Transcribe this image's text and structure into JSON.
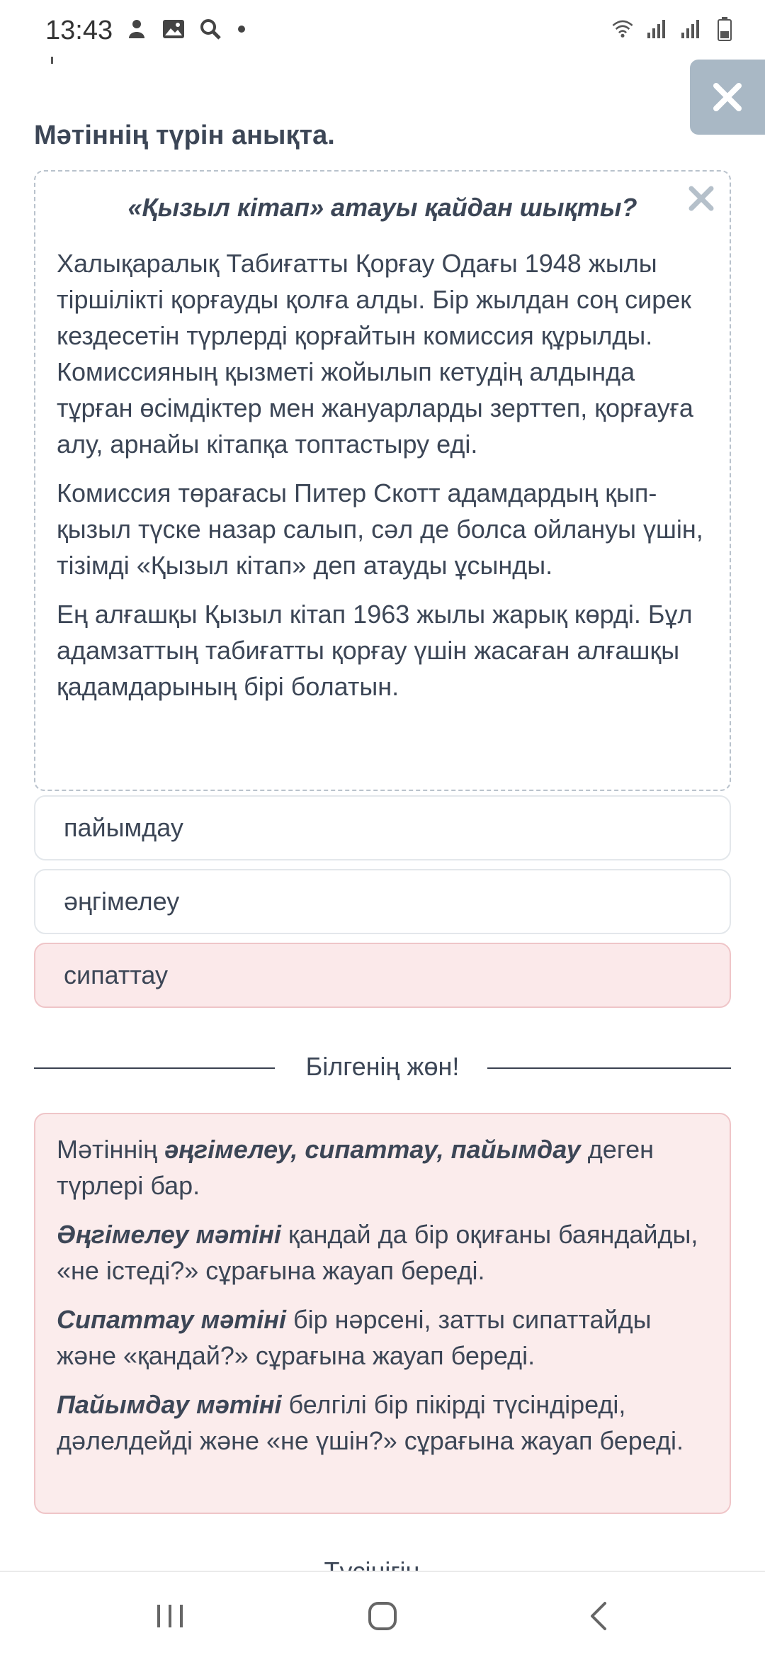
{
  "status_bar": {
    "time": "13:43",
    "left_icons": [
      "person-icon",
      "image-icon",
      "search-icon",
      "dot-icon"
    ],
    "right_icons": [
      "wifi-icon",
      "signal-icon",
      "signal-icon",
      "battery-icon"
    ]
  },
  "question": "Мәтіннің түрін анықта.",
  "text_card": {
    "title": "«Қызыл кітап» атауы қайдан шықты?",
    "paragraphs": [
      "Халықаралық Табиғатты Қорғау Одағы 1948 жылы тіршілікті қорғауды қолға алды. Бір жылдан соң сирек кездесетін түрлерді қорғайтын комиссия құрылды. Комиссияның қызметі жойылып кетудің алдында тұрған өсімдіктер мен жануарларды зерттеп, қорғауға алу, арнайы кітапқа топтастыру еді.",
      "Комиссия төрағасы Питер Скотт адамдардың қып-қызыл түске назар салып, сәл де болса ойлануы үшін, тізімді «Қызыл кітап» деп атауды ұсынды.",
      "Ең алғашқы Қызыл кітап 1963 жылы жарық көрді. Бұл адамзаттың табиғатты қорғау үшін жасаған алғашқы қадамдарының бірі болатын."
    ]
  },
  "options": [
    {
      "label": "пайымдау",
      "state": "default"
    },
    {
      "label": "әңгімелеу",
      "state": "default"
    },
    {
      "label": "сипаттау",
      "state": "wrong"
    }
  ],
  "divider_label": "Білгенің жөн!",
  "info": {
    "p1_pre": "Мәтіннің ",
    "p1_bold": "әңгімелеу, сипаттау, пайымдау",
    "p1_post": " деген түрлері бар.",
    "p2_bold": "Әңгімелеу мәтіні",
    "p2_rest": " қандай да бір оқиғаны баяндайды, «не істеді?» сұрағына жауап береді.",
    "p3_bold": "Сипаттау мәтіні",
    "p3_rest": " бір нәрсені, затты сипаттайды және «қандай?» сұрағына жауап береді.",
    "p4_bold": "Пайымдау мәтіні",
    "p4_rest": " белгілі бір пікірді түсіндіреді, дәлелдейді және «не үшін?» сұрағына жауап береді."
  },
  "partial_label": "Түсінігін...",
  "colors": {
    "wrong_bg": "#fbe9ea",
    "close_button_bg": "#a9b8c5",
    "text": "#3c4656"
  }
}
